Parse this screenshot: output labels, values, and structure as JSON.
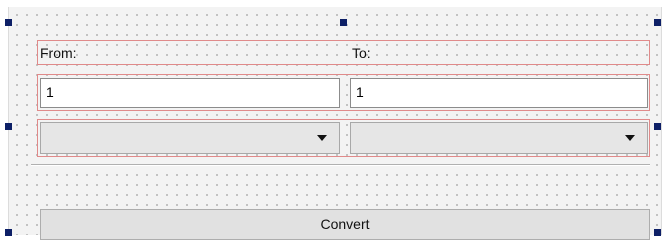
{
  "form": {
    "from_label": "From:",
    "to_label": "To:",
    "from_value": "1",
    "to_value": "1",
    "from_unit_selected": "",
    "to_unit_selected": "",
    "convert_label": "Convert"
  }
}
